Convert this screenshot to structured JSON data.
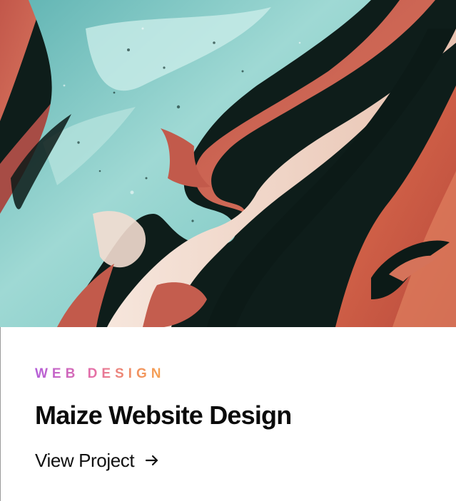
{
  "card": {
    "image_description_icon": "abstract-fluid-art-image",
    "category": "WEB DESIGN",
    "title": "Maize Website Design",
    "link_label": "View Project",
    "link_icon": "arrow-right-icon"
  },
  "colors": {
    "category_gradient": [
      "#b45ed8",
      "#e56fa7",
      "#f08f63",
      "#f6a451"
    ],
    "title": "#0b0b0b",
    "link": "#111111",
    "teal": "#7fcac6",
    "coral": "#c8604f",
    "dark": "#0e1d1a",
    "cream": "#f1ddd2"
  }
}
